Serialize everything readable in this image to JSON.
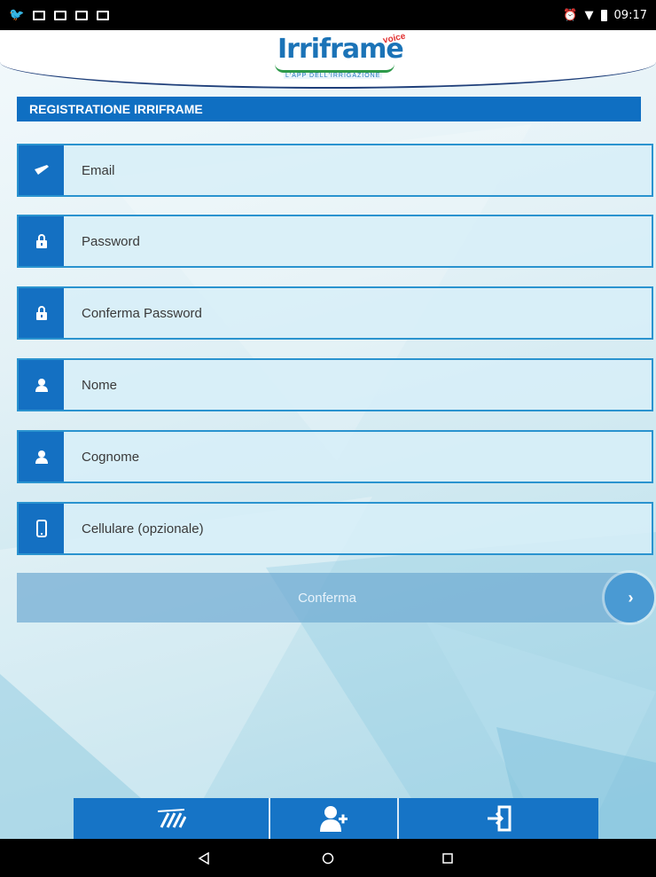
{
  "status_bar": {
    "time": "09:17",
    "left_icons": [
      "twitter-icon",
      "gmail-icon",
      "screenshot-icon",
      "gmail-icon",
      "gmail-icon"
    ],
    "right_icons": [
      "alarm-icon",
      "wifi-icon",
      "battery-icon"
    ]
  },
  "header": {
    "logo_text": "Irriframe",
    "logo_badge": "voice",
    "logo_tagline": "L'APP DELL'IRRIGAZIONE"
  },
  "page": {
    "title": "REGISTRATIONE IRRIFRAME"
  },
  "form": {
    "fields": [
      {
        "placeholder": "Email",
        "icon": "envelope-icon",
        "value": ""
      },
      {
        "placeholder": "Password",
        "icon": "lock-icon",
        "value": ""
      },
      {
        "placeholder": "Conferma Password",
        "icon": "lock-icon",
        "value": ""
      },
      {
        "placeholder": "Nome",
        "icon": "user-icon",
        "value": ""
      },
      {
        "placeholder": "Cognome",
        "icon": "user-icon",
        "value": ""
      },
      {
        "placeholder": "Cellulare (opzionale)",
        "icon": "phone-icon",
        "value": ""
      }
    ],
    "confirm_label": "Conferma",
    "confirm_arrow": "›"
  },
  "bottom_nav": {
    "items": [
      {
        "icon": "field-irrigation-icon"
      },
      {
        "icon": "add-user-icon"
      },
      {
        "icon": "login-icon"
      }
    ]
  },
  "system_nav": {
    "items": [
      "back-icon",
      "home-icon",
      "recents-icon"
    ]
  },
  "colors": {
    "primary_blue": "#1470c2",
    "field_border": "#2a93cf",
    "field_fill": "#d7eef8",
    "confirm_fill": "#6eaad2",
    "header_border": "#1f3f7a",
    "logo_green": "#2e9a4a"
  }
}
